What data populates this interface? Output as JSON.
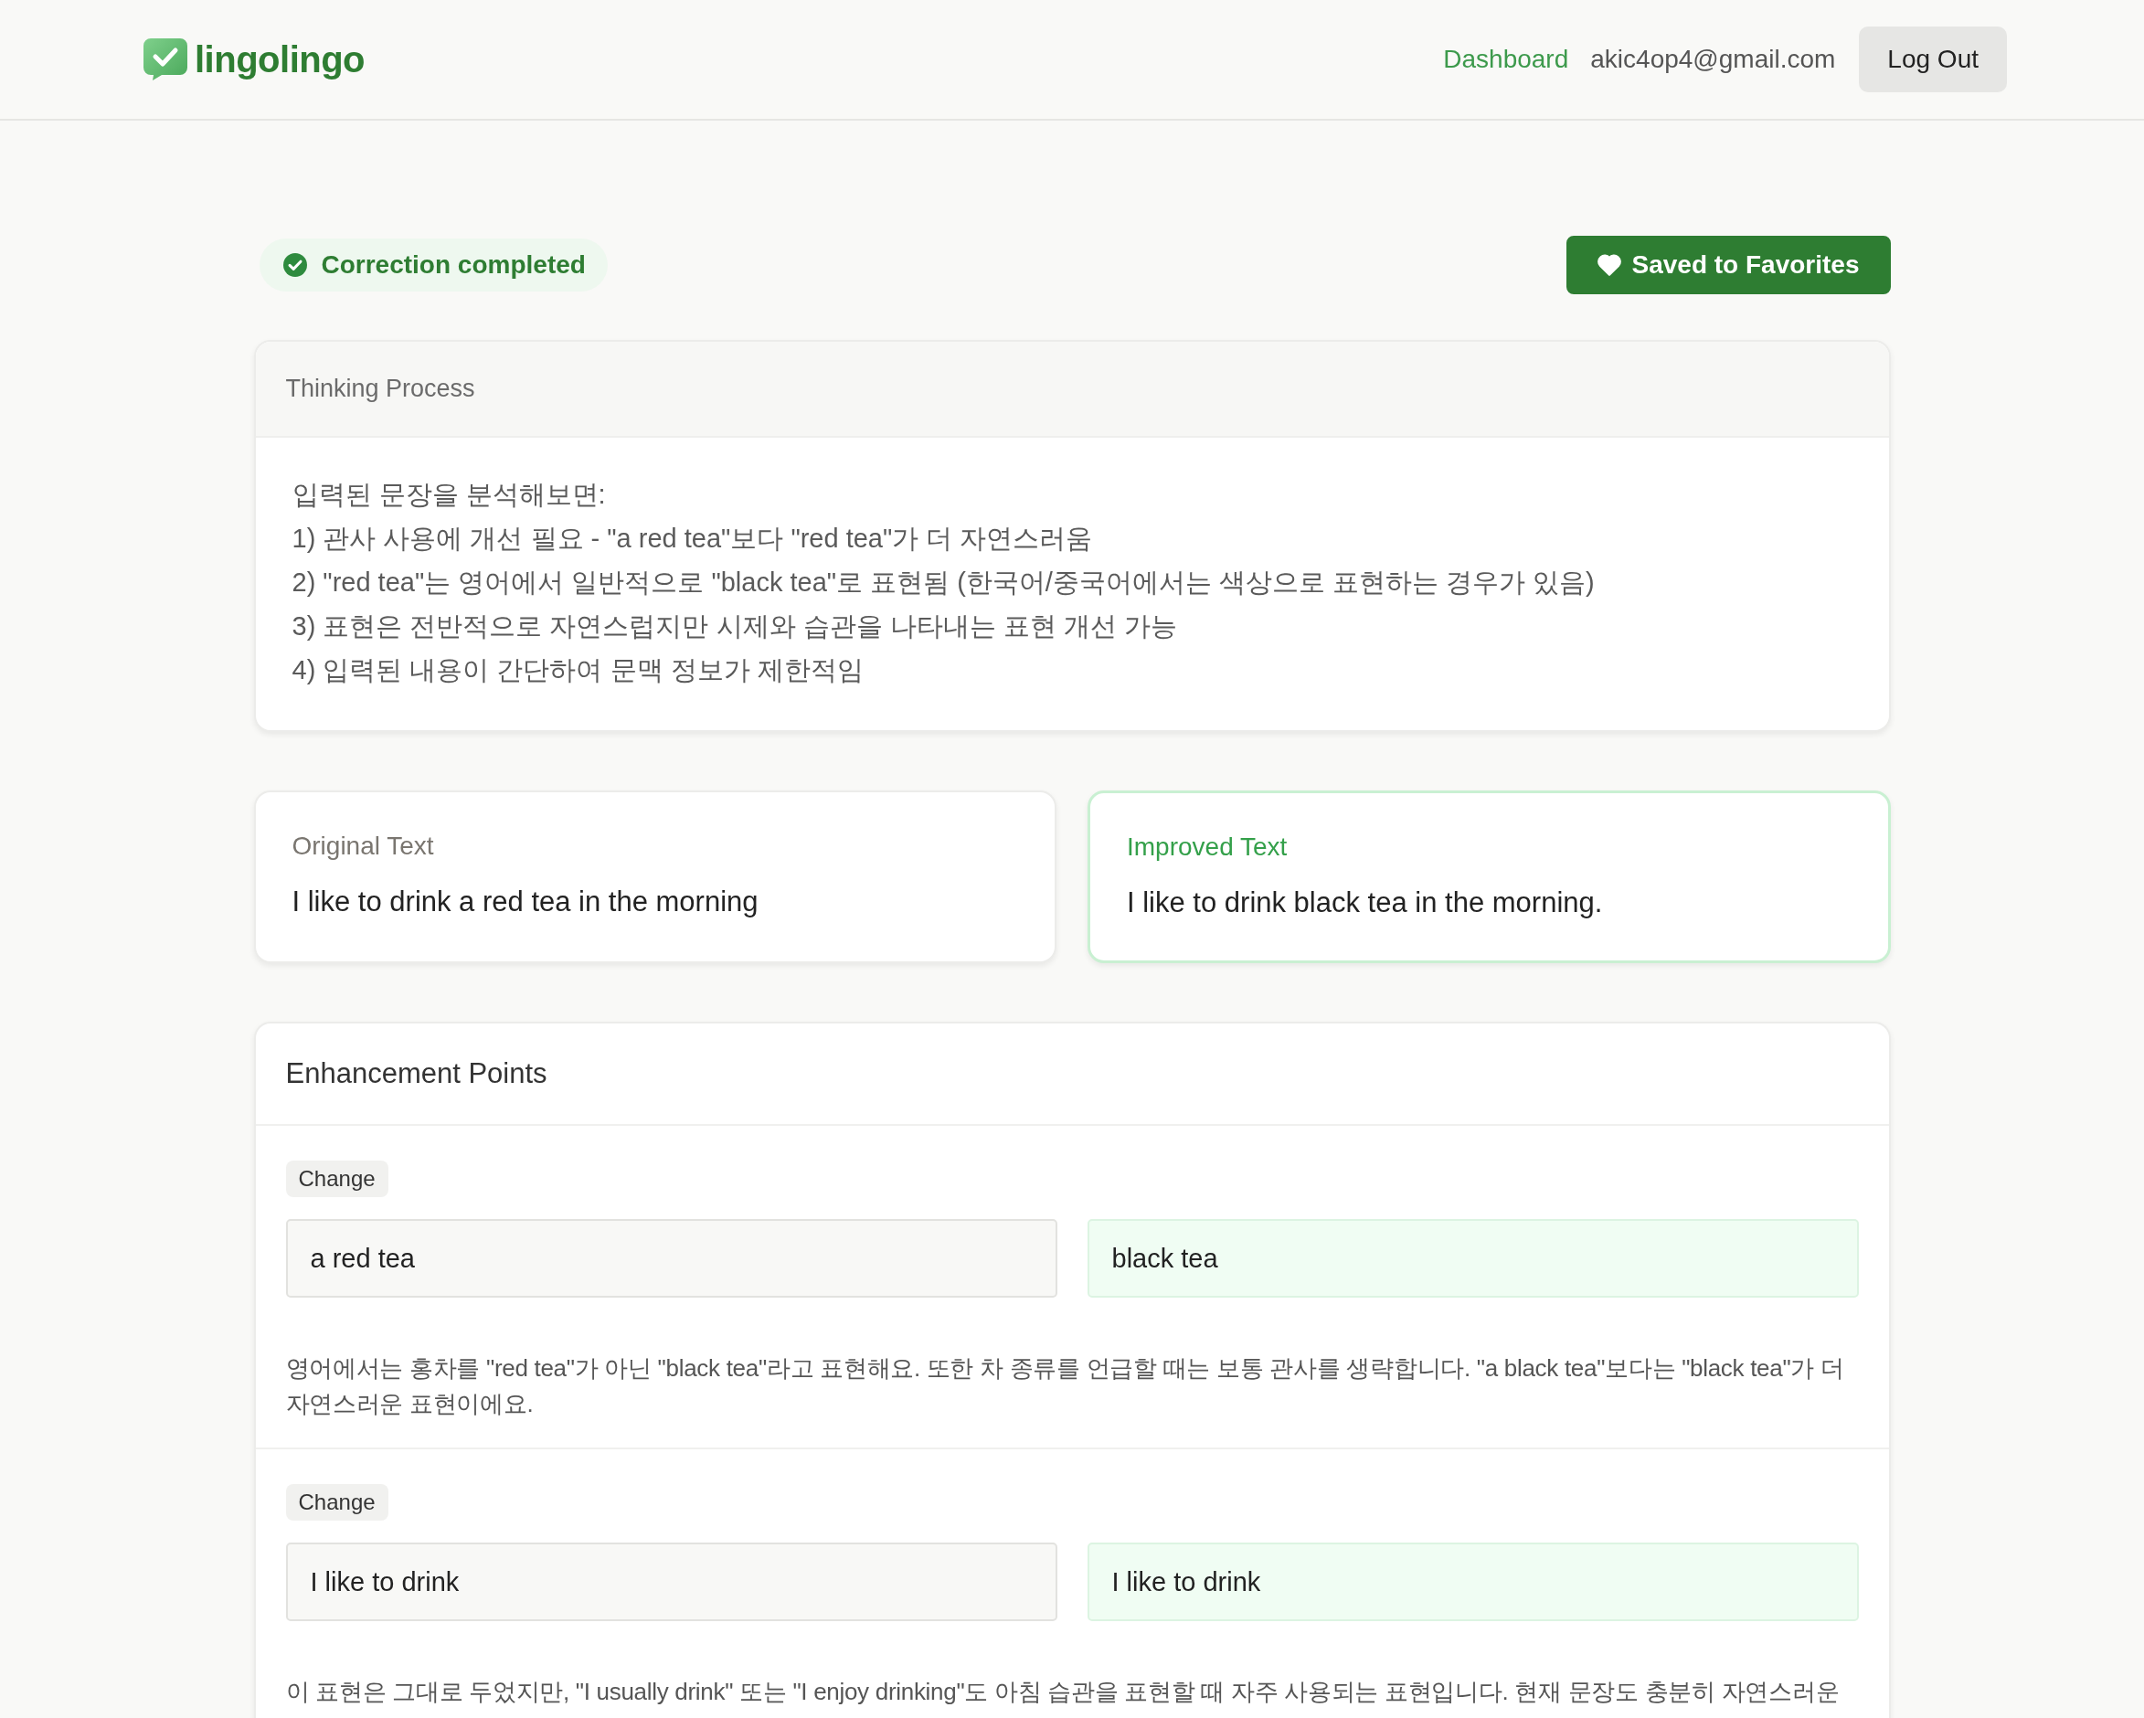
{
  "header": {
    "logo": "lingolingo",
    "links": [
      {
        "label": "Dashboard"
      }
    ],
    "email": "akic4op4@gmail.com",
    "logout_button": "Log Out"
  },
  "status": {
    "label": "Correction completed",
    "favorite": {
      "label": "Saved to Favorites",
      "saved": true
    }
  },
  "thinking": {
    "title": "Thinking Process",
    "lines": [
      "입력된 문장을 분석해보면:",
      "1) 관사 사용에 개선 필요 - \"a red tea\"보다 \"red tea\"가 더 자연스러움",
      "2) \"red tea\"는 영어에서 일반적으로 \"black tea\"로 표현됨 (한국어/중국어에서는 색상으로 표현하는 경우가 있음)",
      "3) 표현은 전반적으로 자연스럽지만 시제와 습관을 나타내는 표현 개선 가능",
      "4) 입력된 내용이 간단하여 문맥 정보가 제한적임"
    ]
  },
  "texts": [
    {
      "kind": "original",
      "label": "Original Text",
      "text": "I like to drink a red tea in the morning"
    },
    {
      "kind": "improved",
      "label": "Improved Text",
      "text": "I like to drink black tea in the morning."
    }
  ],
  "enhancements": {
    "title": "Enhancement Points",
    "items": [
      {
        "tag": "Change",
        "before": "a red tea",
        "after": "black tea",
        "explanation": "영어에서는 홍차를 \"red tea\"가 아닌 \"black tea\"라고 표현해요. 또한 차 종류를 언급할 때는 보통 관사를 생략합니다. \"a black tea\"보다는 \"black tea\"가 더 자연스러운 표현이에요."
      },
      {
        "tag": "Change",
        "before": "I like to drink",
        "after": "I like to drink",
        "explanation": "이 표현은 그대로 두었지만, \"I usually drink\" 또는 \"I enjoy drinking\"도 아침 습관을 표현할 때 자주 사용되는 표현입니다. 현재 문장도 충분히 자연스러운"
      }
    ]
  }
}
